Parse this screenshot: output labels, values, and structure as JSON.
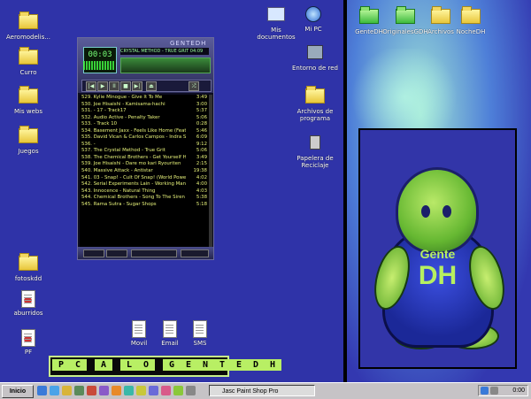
{
  "desktop_icons_left": [
    {
      "label": "Aeromodelis..."
    },
    {
      "label": "Curro"
    },
    {
      "label": "Mis webs"
    },
    {
      "label": "Juegos"
    },
    {
      "label": "fotoskdd"
    },
    {
      "label": "aburridos"
    },
    {
      "label": "PF"
    }
  ],
  "desktop_icons_center": [
    {
      "label": "Mis documentos"
    },
    {
      "label": "Mi PC"
    },
    {
      "label": "Entorno de red"
    },
    {
      "label": "Archivos de programa"
    },
    {
      "label": "Papelera de Reciclaje"
    },
    {
      "label": "Movil"
    },
    {
      "label": "Email"
    },
    {
      "label": "SMS"
    }
  ],
  "desktop_icons_right": [
    {
      "label": "GenteDH"
    },
    {
      "label": "OriginalesGDH"
    },
    {
      "label": "Archivos"
    },
    {
      "label": "NocheDH"
    }
  ],
  "player": {
    "title": "GENTEDH",
    "time": "00:03",
    "ticker": "CRYSTAL METHOD - TRUE GRIT 04:09",
    "playlist": [
      {
        "title": "529. Kylie Minogue - Give It To Me",
        "duration": "3:49"
      },
      {
        "title": "530. Joe Hisaishi - Kamisama-hachi",
        "duration": "3:00"
      },
      {
        "title": "531.  - 17 - Track17",
        "duration": "5:37"
      },
      {
        "title": "532. Audio Active - Penalty Taker",
        "duration": "5:06"
      },
      {
        "title": "533.  - Track 10",
        "duration": "0:28"
      },
      {
        "title": "534. Basement Jaxx - Feels Like Home (Feat M",
        "duration": "5:46"
      },
      {
        "title": "535. David Vican & Carlos Campos - Indra Story",
        "duration": "6:09"
      },
      {
        "title": "536.  -",
        "duration": "9:12"
      },
      {
        "title": "537. The Crystal Method - True Grit",
        "duration": "5:06"
      },
      {
        "title": "538. The Chemical Brothers - Get Yourself High",
        "duration": "3:49"
      },
      {
        "title": "539. Joe Hisaishi - Dare mo kari Ryouriten",
        "duration": "2:15"
      },
      {
        "title": "540. Massive Attack - Antistar",
        "duration": "19:38"
      },
      {
        "title": "541. 03 - Snap! - Cult Of Snap! (World Power",
        "duration": "4:02"
      },
      {
        "title": "542. Serial Experiments Lain - Working Man's",
        "duration": "4:00"
      },
      {
        "title": "543. Innocence - Natural Thing",
        "duration": "4:03"
      },
      {
        "title": "544. Chemical Brothers - Song To The Siren",
        "duration": "5:38"
      },
      {
        "title": "545. Rama Sutra - Sugar Shops",
        "duration": "5:18"
      }
    ]
  },
  "banner": {
    "letters": [
      "P",
      "C",
      "",
      "A",
      "",
      "L",
      "O",
      "",
      "G",
      "E",
      "N",
      "T",
      "E",
      "D",
      "H"
    ]
  },
  "wallpaper": {
    "line1": "Gente",
    "line2": "DH"
  },
  "taskbar": {
    "start_label": "Inicio",
    "task_label": "Jasc Paint Shop Pro",
    "clock": "0:00"
  }
}
